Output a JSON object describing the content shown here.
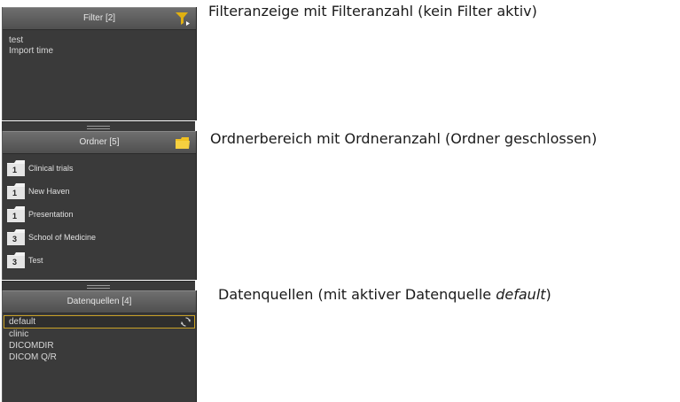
{
  "filter": {
    "title": "Filter [2]",
    "items": [
      "test",
      "Import time"
    ]
  },
  "folders": {
    "title": "Ordner [5]",
    "items": [
      {
        "count": "1",
        "label": "Clinical trials"
      },
      {
        "count": "1",
        "label": "New Haven"
      },
      {
        "count": "1",
        "label": "Presentation"
      },
      {
        "count": "3",
        "label": "School of Medicine"
      },
      {
        "count": "3",
        "label": "Test"
      }
    ]
  },
  "datasources": {
    "title": "Datenquellen [4]",
    "items": [
      "default",
      "clinic",
      "DICOMDIR",
      "DICOM Q/R"
    ],
    "active": "default"
  },
  "captions": {
    "filter": "Filteranzeige mit Filteranzahl (kein Filter aktiv)",
    "folders": "Ordnerbereich mit Ordneranzahl (Ordner geschlossen)",
    "datasources_prefix": "Datenquellen (mit aktiver Datenquelle ",
    "datasources_em": "default",
    "datasources_suffix": ")"
  },
  "colors": {
    "filter_icon": "#e0b010",
    "folder_icon": "#f0c020",
    "active_border": "#c9a227",
    "panel_bg": "#3a3a3a"
  },
  "icons": {
    "filter": "funnel-icon",
    "folder": "folder-icon",
    "sync": "sync-icon"
  }
}
